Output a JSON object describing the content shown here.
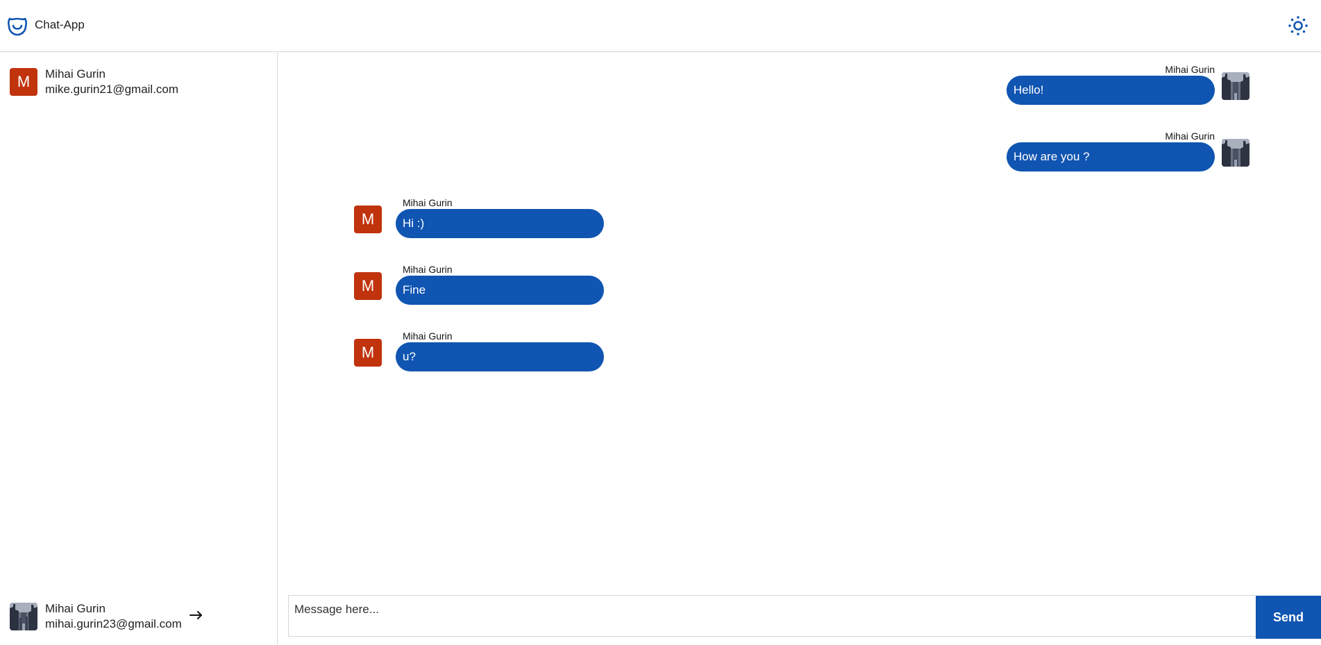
{
  "header": {
    "app_title": "Chat-App",
    "logo_icon": "smile-logo-icon",
    "theme_icon": "sun-icon"
  },
  "sidebar": {
    "contacts": [
      {
        "avatar_letter": "M",
        "name": "Mihai Gurin",
        "email": "mike.gurin21@gmail.com"
      }
    ],
    "current_user": {
      "name": "Mihai Gurin",
      "email": "mihai.gurin23@gmail.com",
      "logout_icon": "arrow-right-icon"
    }
  },
  "messages": [
    {
      "side": "mine",
      "author": "Mihai Gurin",
      "text": "Hello!"
    },
    {
      "side": "mine",
      "author": "Mihai Gurin",
      "text": "How are you ?"
    },
    {
      "side": "theirs",
      "author": "Mihai Gurin",
      "avatar_letter": "M",
      "text": "Hi :)"
    },
    {
      "side": "theirs",
      "author": "Mihai Gurin",
      "avatar_letter": "M",
      "text": "Fine"
    },
    {
      "side": "theirs",
      "author": "Mihai Gurin",
      "avatar_letter": "M",
      "text": "u?"
    }
  ],
  "composer": {
    "placeholder": "Message here...",
    "value": "",
    "send_label": "Send"
  },
  "colors": {
    "accent": "#1055b1",
    "avatar": "#c0330d",
    "border": "#d6d6d6"
  }
}
